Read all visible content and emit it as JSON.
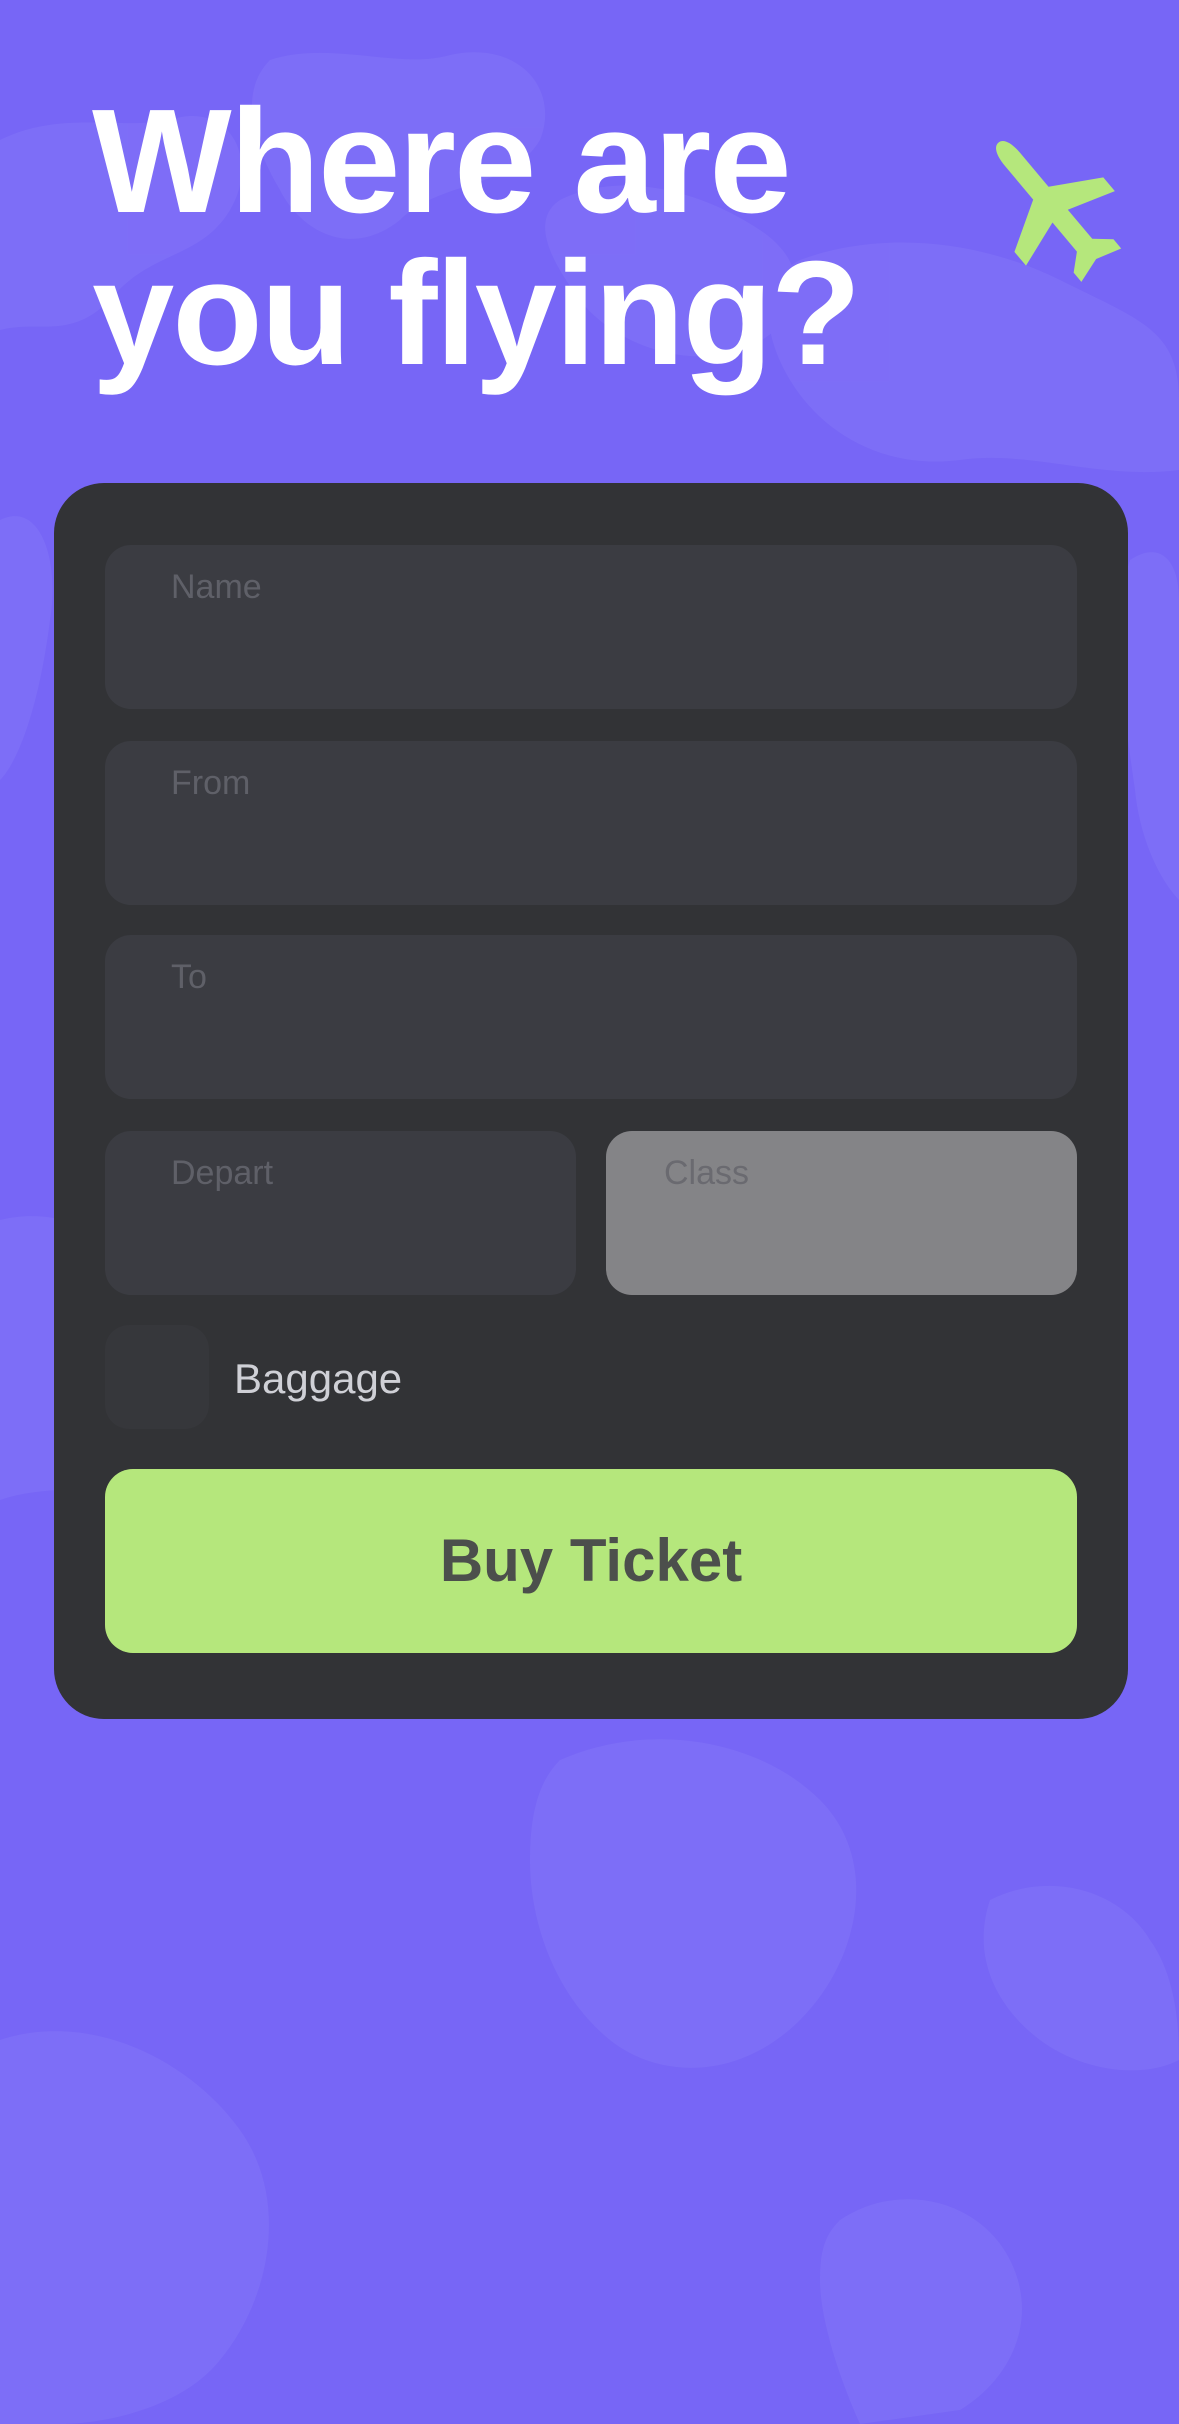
{
  "colors": {
    "background": "#7766f6",
    "map_overlay": "#8474f8",
    "card": "#323336",
    "field": "#3b3c42",
    "field_selected": "#848487",
    "accent": "#b5e77c",
    "headline": "#ffffff"
  },
  "header": {
    "title_line1": "Where are",
    "title_line2": "you flying?",
    "icon": "airplane-icon"
  },
  "form": {
    "name_label": "Name",
    "from_label": "From",
    "to_label": "To",
    "depart_label": "Depart",
    "class_label": "Class",
    "baggage_label": "Baggage",
    "baggage_checked": false,
    "buy_label": "Buy Ticket"
  },
  "background": {
    "icon": "world-map-decoration"
  }
}
